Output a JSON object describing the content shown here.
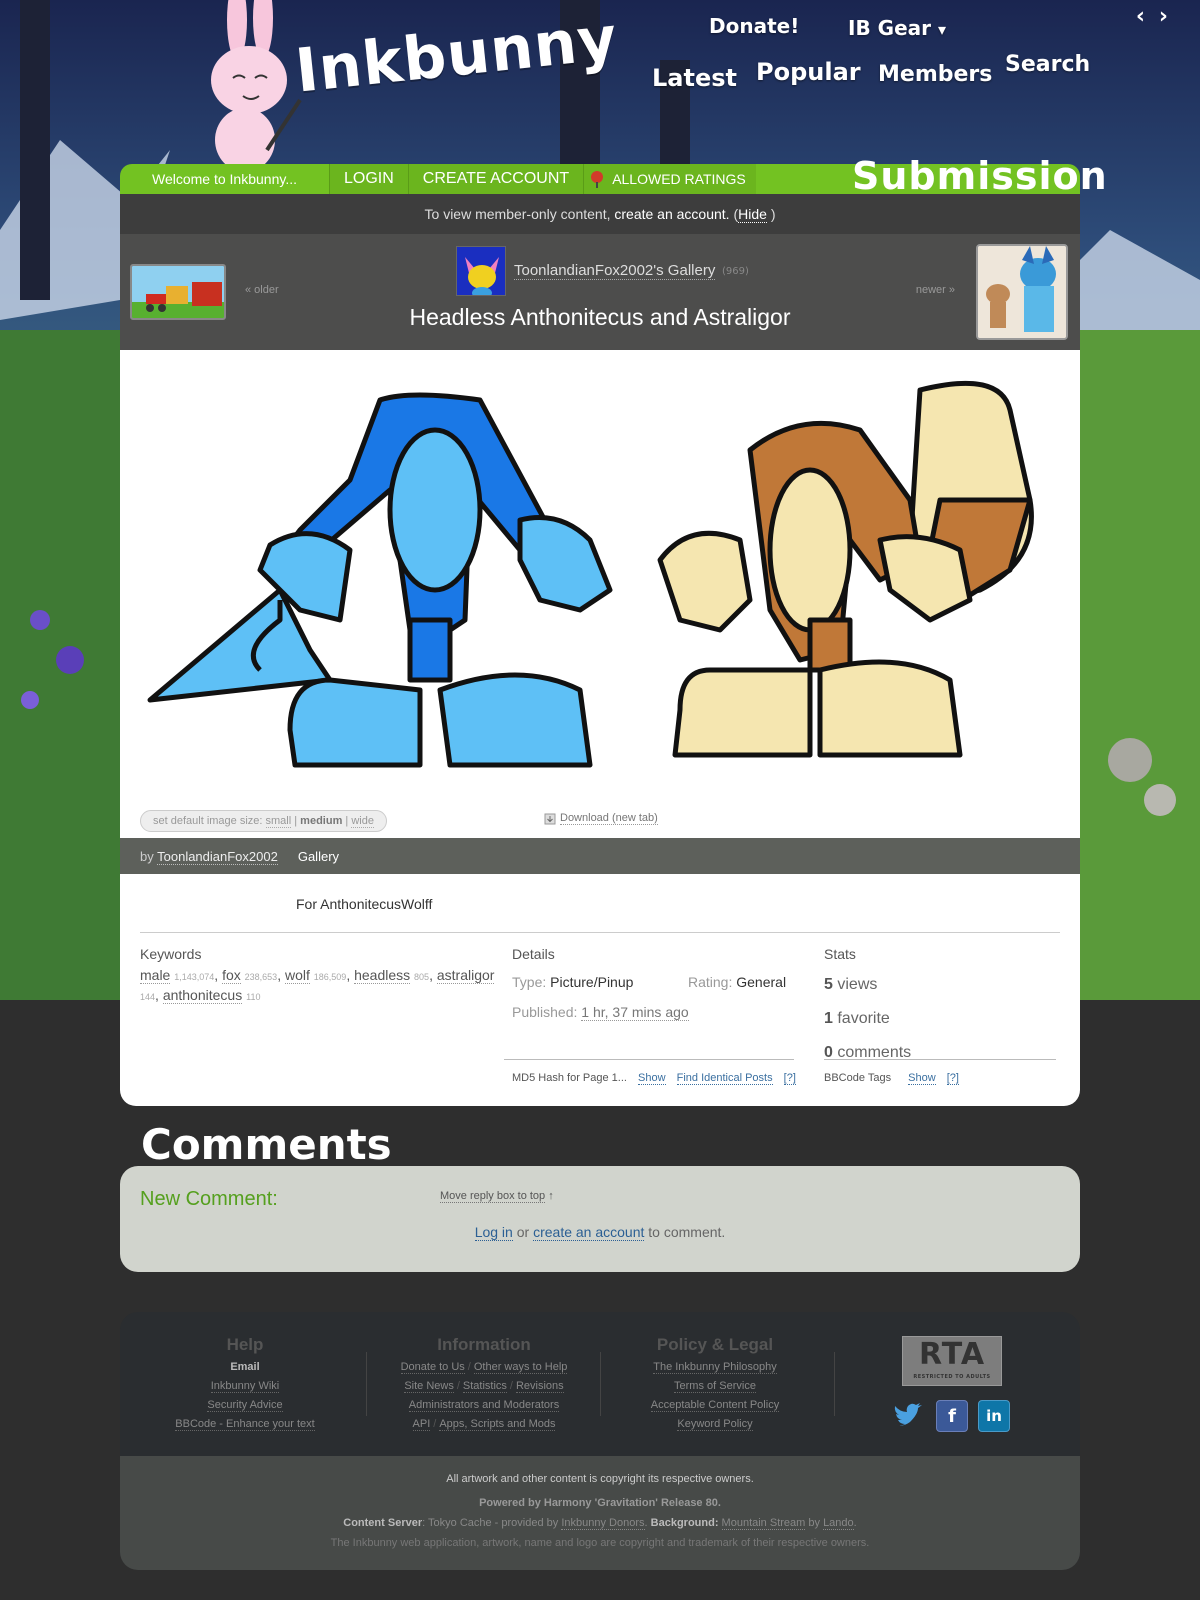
{
  "header": {
    "logo_text": "Inkbunny",
    "donate": "Donate!",
    "ib_gear": "IB Gear",
    "nav": [
      "Latest",
      "Popular",
      "Members",
      "Search"
    ],
    "prev_arrow": "‹",
    "next_arrow": "›"
  },
  "greenbar": {
    "welcome": "Welcome to Inkbunny...",
    "login": "LOGIN",
    "create_account": "CREATE ACCOUNT",
    "allowed_ratings": "ALLOWED RATINGS",
    "section_title": "Submission"
  },
  "notice": {
    "text": "To view member-only content,",
    "link": "create an account.",
    "hide_prefix": "(",
    "hide": "Hide",
    "hide_suffix": ")"
  },
  "gallery": {
    "older": "« older",
    "newer": "newer »",
    "gallery_link": "ToonlandianFox2002's Gallery",
    "count": "(969)",
    "title": "Headless Anthonitecus and Astraligor"
  },
  "image_controls": {
    "size_label": "set default image size:",
    "small": "small",
    "medium": "medium",
    "wide": "wide",
    "download": "Download (new tab)"
  },
  "bybar": {
    "by": "by",
    "user": "ToonlandianFox2002",
    "gallery": "Gallery"
  },
  "description": "For AnthonitecusWolff",
  "keywords": {
    "heading": "Keywords",
    "items": [
      {
        "word": "male",
        "count": "1,143,074"
      },
      {
        "word": "fox",
        "count": "238,653"
      },
      {
        "word": "wolf",
        "count": "186,509"
      },
      {
        "word": "headless",
        "count": "805"
      },
      {
        "word": "astraligor",
        "count": "144"
      },
      {
        "word": "anthonitecus",
        "count": "110"
      }
    ]
  },
  "details": {
    "heading": "Details",
    "type_label": "Type:",
    "type": "Picture/Pinup",
    "rating_label": "Rating:",
    "rating": "General",
    "published_label": "Published:",
    "published": "1 hr, 37 mins ago",
    "md5_label": "MD5 Hash for Page 1...",
    "show": "Show",
    "find_identical": "Find Identical Posts",
    "help": "[?]"
  },
  "stats": {
    "heading": "Stats",
    "views_num": "5",
    "views": "views",
    "favorite_num": "1",
    "favorite": "favorite",
    "comments_num": "0",
    "comments": "comments",
    "bbcode_label": "BBCode Tags",
    "show": "Show",
    "help": "[?]"
  },
  "comments": {
    "heading": "Comments",
    "new_comment": "New Comment:",
    "move_reply": "Move reply box to top",
    "move_arrow": "↑",
    "log_in": "Log in",
    "or": "or",
    "create_account": "create an account",
    "to_comment": "to comment."
  },
  "footer": {
    "help": {
      "heading": "Help",
      "email": "Email",
      "wiki": "Inkbunny Wiki",
      "security": "Security Advice",
      "bbcode": "BBCode - Enhance your text"
    },
    "information": {
      "heading": "Information",
      "donate": "Donate to Us",
      "other_ways": "Other ways to Help",
      "site_news": "Site News",
      "statistics": "Statistics",
      "revisions": "Revisions",
      "admins": "Administrators and Moderators",
      "api": "API",
      "apps": "Apps, Scripts and Mods"
    },
    "policy": {
      "heading": "Policy & Legal",
      "philosophy": "The Inkbunny Philosophy",
      "terms": "Terms of Service",
      "acp": "Acceptable Content Policy",
      "keyword": "Keyword Policy"
    },
    "rta": {
      "big": "RTA",
      "small": "RESTRICTED TO ADULTS"
    },
    "copyright": "All artwork and other content is copyright its respective owners.",
    "powered": "Powered by Harmony 'Gravitation' Release 80.",
    "content_server_label": "Content Server",
    "content_server": ": Tokyo Cache - provided by",
    "donors": "Inkbunny Donors",
    "background_label": "Background:",
    "background": "Mountain Stream",
    "by": "by",
    "lando": "Lando",
    "trademark": "The Inkbunny web application, artwork, name and logo are copyright and trademark of their respective owners."
  },
  "colors": {
    "green": "#73c222",
    "comment_green": "#55a01e",
    "link_blue": "#2b5f94",
    "dark_panel": "#4d4d4c"
  }
}
